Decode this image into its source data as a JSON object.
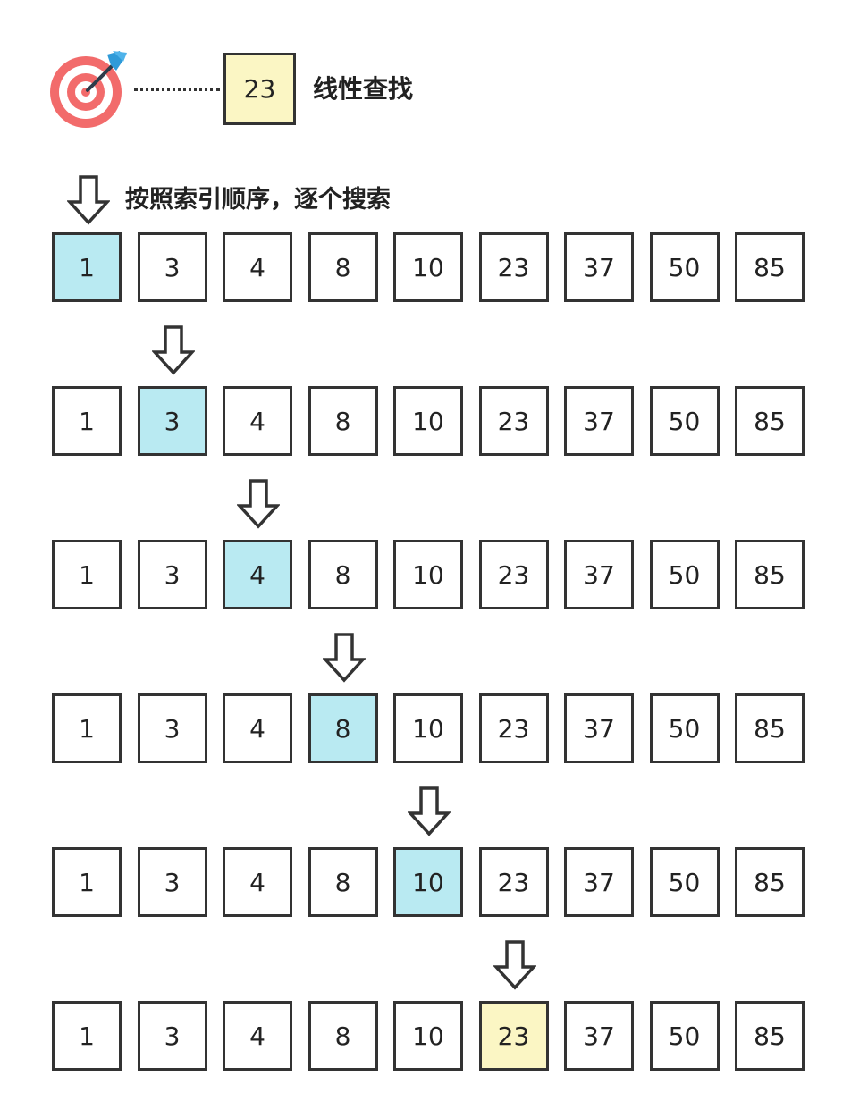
{
  "header": {
    "target_value": "23",
    "title": "线性查找",
    "caption": "按照索引顺序，逐个搜索"
  },
  "colors": {
    "visited": "#b9eaf2",
    "found": "#fbf6c4",
    "target_box": "#fbf6c4",
    "target_red": "#f26b6b",
    "dart_blue": "#2f9ad8"
  },
  "icons": {
    "target": "target-icon",
    "arrow": "down-arrow-icon"
  },
  "array": [
    "1",
    "3",
    "4",
    "8",
    "10",
    "23",
    "37",
    "50",
    "85"
  ],
  "steps": [
    {
      "index": 0,
      "state": "visited"
    },
    {
      "index": 1,
      "state": "visited"
    },
    {
      "index": 2,
      "state": "visited"
    },
    {
      "index": 3,
      "state": "visited"
    },
    {
      "index": 4,
      "state": "visited"
    },
    {
      "index": 5,
      "state": "found"
    }
  ]
}
